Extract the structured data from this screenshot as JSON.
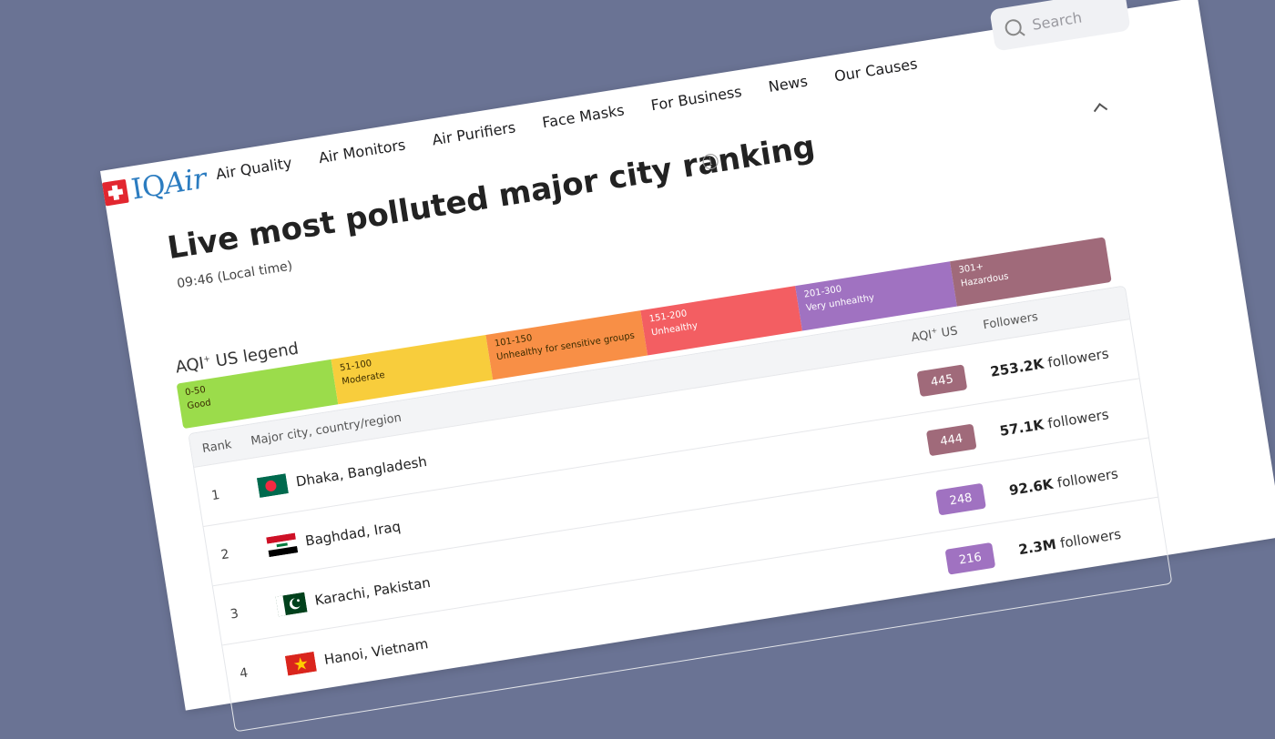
{
  "header": {
    "logo": {
      "iq": "IQ",
      "air": "Air"
    },
    "nav": [
      "Air Quality",
      "Air Monitors",
      "Air Purifiers",
      "Face Masks",
      "For Business",
      "News",
      "Our Causes"
    ],
    "search_placeholder": "Search"
  },
  "page": {
    "title": "Live most polluted major city ranking",
    "local_time": "09:46 (Local time)"
  },
  "legend": {
    "title_main": "AQI",
    "title_sup": "+",
    "title_rest": " US legend",
    "bands": [
      {
        "range": "0-50",
        "name": "Good",
        "color": "#9bdc4b"
      },
      {
        "range": "51-100",
        "name": "Moderate",
        "color": "#f8cd3c"
      },
      {
        "range": "101-150",
        "name": "Unhealthy for sensitive groups",
        "color": "#f88f46"
      },
      {
        "range": "151-200",
        "name": "Unhealthy",
        "color": "#f35e62"
      },
      {
        "range": "201-300",
        "name": "Very unhealthy",
        "color": "#a072c1"
      },
      {
        "range": "301+",
        "name": "Hazardous",
        "color": "#a06a7a"
      }
    ]
  },
  "table": {
    "col_rank": "Rank",
    "col_city": "Major city, country/region",
    "col_aqi": "AQI",
    "col_aqi_sup": "+",
    "col_aqi_rest": " US",
    "col_followers": "Followers",
    "rows": [
      {
        "rank": "1",
        "city": "Dhaka, Bangladesh",
        "flag": "bangladesh-flag",
        "aqi": "445",
        "aqi_color": "#a06a7a",
        "followers_num": "253.2K",
        "followers_word": " followers"
      },
      {
        "rank": "2",
        "city": "Baghdad, Iraq",
        "flag": "iraq-flag",
        "aqi": "444",
        "aqi_color": "#a06a7a",
        "followers_num": "57.1K",
        "followers_word": " followers"
      },
      {
        "rank": "3",
        "city": "Karachi, Pakistan",
        "flag": "pakistan-flag",
        "aqi": "248",
        "aqi_color": "#a072c1",
        "followers_num": "92.6K",
        "followers_word": " followers"
      },
      {
        "rank": "4",
        "city": "Hanoi, Vietnam",
        "flag": "vietnam-flag",
        "aqi": "216",
        "aqi_color": "#a072c1",
        "followers_num": "2.3M",
        "followers_word": " followers"
      }
    ]
  }
}
